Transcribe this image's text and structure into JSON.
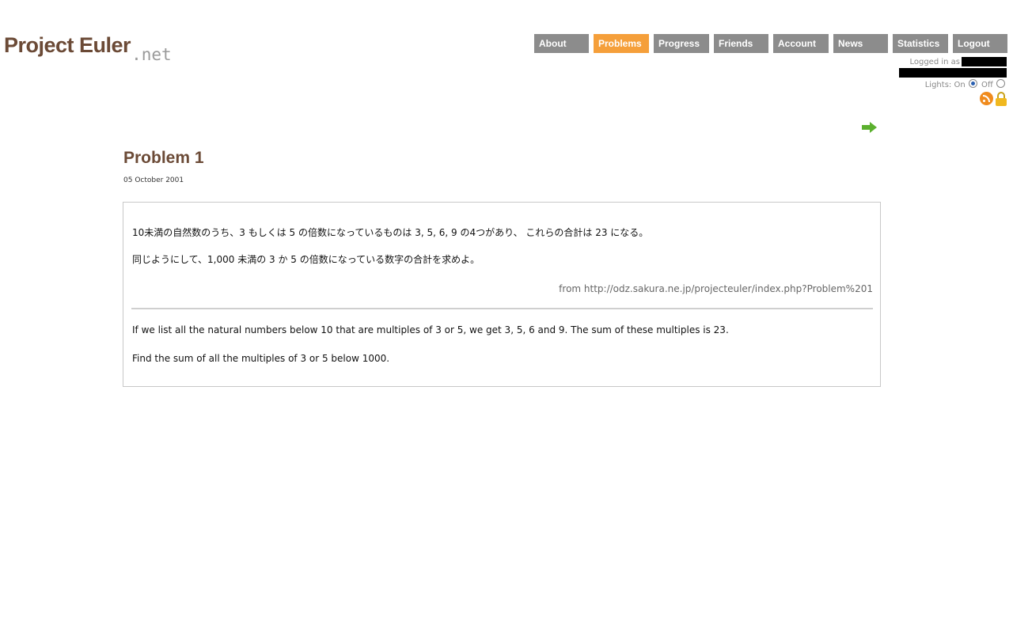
{
  "logo": {
    "main": "Project Euler",
    "suffix": ".net"
  },
  "nav": {
    "items": [
      {
        "label": "About"
      },
      {
        "label": "Problems",
        "active": true
      },
      {
        "label": "Progress"
      },
      {
        "label": "Friends"
      },
      {
        "label": "Account"
      },
      {
        "label": "News"
      },
      {
        "label": "Statistics"
      },
      {
        "label": "Logout"
      }
    ]
  },
  "user": {
    "logged_in_label": "Logged in as",
    "lights_label": "Lights: On",
    "lights_off_label": "Off",
    "lights_on_selected": true
  },
  "icons": {
    "rss": "rss-icon",
    "lock": "lock-icon",
    "next": "arrow-right-icon"
  },
  "problem": {
    "title": "Problem 1",
    "date": "05 October 2001",
    "jp_line1": "10未満の自然数のうち、3 もしくは 5 の倍数になっているものは 3, 5, 6, 9 の4つがあり、 これらの合計は 23 になる。",
    "jp_line2": "同じようにして、1,000 未満の 3 か 5 の倍数になっている数字の合計を求めよ。",
    "source": "from http://odz.sakura.ne.jp/projecteuler/index.php?Problem%201",
    "en_line1": "If we list all the natural numbers below 10 that are multiples of 3 or 5, we get 3, 5, 6 and 9. The sum of these multiples is 23.",
    "en_line2": "Find the sum of all the multiples of 3 or 5 below 1000."
  },
  "colors": {
    "brand": "#6b4a36",
    "nav_bg": "#8c8c8c",
    "nav_active": "#f59f3a",
    "arrow": "#5bb02e"
  }
}
